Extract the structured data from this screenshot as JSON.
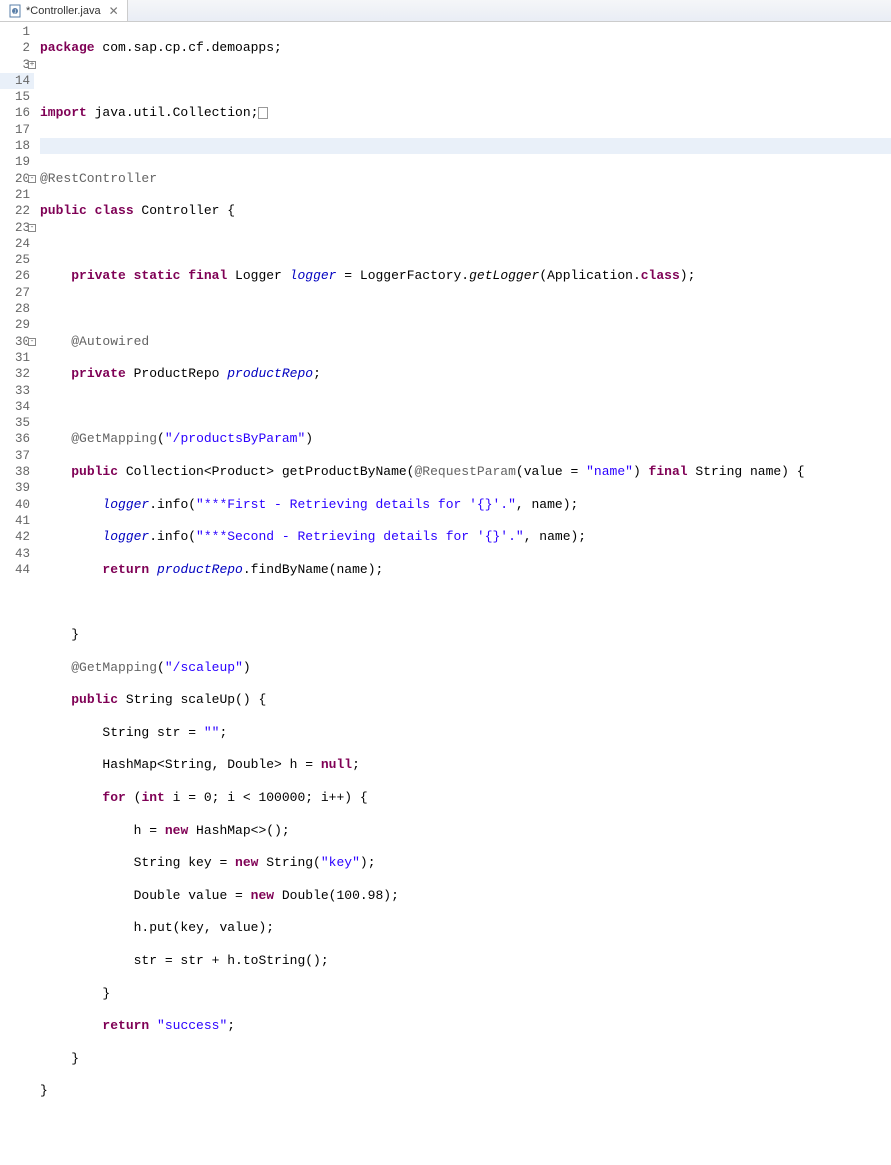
{
  "tab": {
    "title": "*Controller.java",
    "close_glyph": "✕"
  },
  "gutter": {
    "lines": [
      "1",
      "2",
      "3",
      "14",
      "15",
      "16",
      "17",
      "18",
      "19",
      "20",
      "21",
      "22",
      "23",
      "24",
      "25",
      "26",
      "27",
      "28",
      "29",
      "30",
      "31",
      "32",
      "33",
      "34",
      "35",
      "36",
      "37",
      "38",
      "39",
      "40",
      "41",
      "42",
      "43",
      "44"
    ]
  },
  "code": {
    "l1_kw": "package",
    "l1_rest": " com.sap.cp.cf.demoapps;",
    "l3_kw": "import",
    "l3_rest": " java.util.Collection;",
    "l15_ann": "@RestController",
    "l16_kw1": "public",
    "l16_kw2": " class",
    "l16_rest": " Controller {",
    "l18_kw1": "private",
    "l18_kw2": " static",
    "l18_kw3": " final",
    "l18_t1": " Logger ",
    "l18_fld": "logger",
    "l18_t2": " = LoggerFactory.",
    "l18_m": "getLogger",
    "l18_t3": "(Application.",
    "l18_kw4": "class",
    "l18_t4": ");",
    "l20_ann": "@Autowired",
    "l21_kw": "private",
    "l21_t1": " ProductRepo ",
    "l21_fld": "productRepo",
    "l21_t2": ";",
    "l23_ann": "@GetMapping",
    "l23_p": "(",
    "l23_str": "\"/productsByParam\"",
    "l23_p2": ")",
    "l24_kw": "public",
    "l24_t1": " Collection<Product> getProductByName(",
    "l24_ann": "@RequestParam",
    "l24_t2": "(value = ",
    "l24_str": "\"name\"",
    "l24_t3": ") ",
    "l24_kw2": "final",
    "l24_t4": " String name) {",
    "l25_fld": "logger",
    "l25_t1": ".info(",
    "l25_str": "\"***First - Retrieving details for '{}'.\"",
    "l25_t2": ", name);",
    "l26_fld": "logger",
    "l26_t1": ".info(",
    "l26_str": "\"***Second - Retrieving details for '{}'.\"",
    "l26_t2": ", name);",
    "l27_kw": "return",
    "l27_t1": " ",
    "l27_fld": "productRepo",
    "l27_t2": ".findByName(name);",
    "l29_t": "}",
    "l30_ann": "@GetMapping",
    "l30_p": "(",
    "l30_str": "\"/scaleup\"",
    "l30_p2": ")",
    "l31_kw": "public",
    "l31_t": " String scaleUp() {",
    "l32_t1": "String str = ",
    "l32_str": "\"\"",
    "l32_t2": ";",
    "l33_t1": "HashMap<String, Double> h = ",
    "l33_kw": "null",
    "l33_t2": ";",
    "l34_kw1": "for",
    "l34_t1": " (",
    "l34_kw2": "int",
    "l34_t2": " i = 0; i < 100000; i++) {",
    "l35_t1": "h = ",
    "l35_kw": "new",
    "l35_t2": " HashMap<>();",
    "l36_t1": "String key = ",
    "l36_kw": "new",
    "l36_t2": " String(",
    "l36_str": "\"key\"",
    "l36_t3": ");",
    "l37_t1": "Double value = ",
    "l37_kw": "new",
    "l37_t2": " Double(100.98);",
    "l38_t": "h.put(key, value);",
    "l39_t": "str = str + h.toString();",
    "l40_t": "}",
    "l41_kw": "return",
    "l41_t1": " ",
    "l41_str": "\"success\"",
    "l41_t2": ";",
    "l42_t": "}",
    "l43_t": "}"
  }
}
